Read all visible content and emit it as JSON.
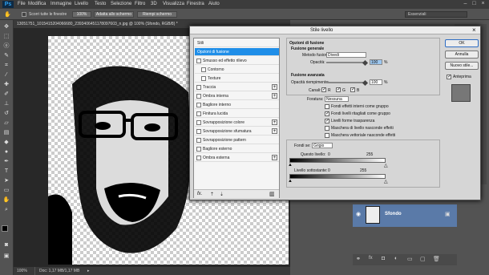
{
  "app": {
    "logo": "Ps"
  },
  "menu": [
    "File",
    "Modifica",
    "Immagine",
    "Livello",
    "Testo",
    "Selezione",
    "Filtro",
    "3D",
    "Visualizza",
    "Finestra",
    "Aiuto"
  ],
  "options": {
    "scroll_all": "Scorri tutte le finestre",
    "zoom": "100%",
    "fit": "Adatta allo schermo",
    "fill": "Riempi schermo",
    "workspace": "Essenziali"
  },
  "document": {
    "tab": "13051751_1015415204066680_2393406451178097603_n.jpg @ 100% (Sfondo, RGB/8) *",
    "status": "100%",
    "doc_size": "Doc: 1,17 MB/1,17 MB"
  },
  "dialog": {
    "title": "Stile livello",
    "styles": [
      "Stili",
      "Opzioni di fusione",
      "Smusso ed effetto rilievo",
      "Contorno",
      "Texture",
      "Traccia",
      "Ombra interna",
      "Bagliore interno",
      "Finitura lucida",
      "Sovrapposizione colore",
      "Sovrapposizione sfumatura",
      "Sovrapposizione pattern",
      "Bagliore esterno",
      "Ombra esterna"
    ],
    "buttons": {
      "ok": "OK",
      "cancel": "Annulla",
      "new_style": "Nuovo stile...",
      "preview": "Anteprima"
    },
    "fx": "fx.",
    "general": {
      "header": "Opzioni di fusione",
      "sub": "Fusione generale",
      "mode_label": "Metodo fusione:",
      "mode_value": "Divedi",
      "opacity_label": "Opacità:",
      "opacity_value": "100",
      "pct": "%"
    },
    "advanced": {
      "sub": "Fusione avanzata",
      "fill_label": "Opacità riempimento:",
      "fill_value": "100",
      "channels_label": "Canali:",
      "r": "R",
      "g": "G",
      "b": "B",
      "knockout_label": "Foratura:",
      "knockout_value": "Nessuna",
      "checks": [
        "Fondi effetti interni come gruppo",
        "Fondi livelli ritagliati come gruppo",
        "Livelli forme trasparenza",
        "Maschera di livello nasconde effetti",
        "Maschera vettoriale nasconde effetti"
      ]
    },
    "blendif": {
      "label": "Fondi se:",
      "value": "Grigio",
      "this_layer": "Questo livello:",
      "this_min": "0",
      "this_max": "255",
      "under_layer": "Livello sottostante:",
      "under_min": "0",
      "under_max": "255"
    }
  },
  "layers": {
    "name": "Sfondo"
  }
}
